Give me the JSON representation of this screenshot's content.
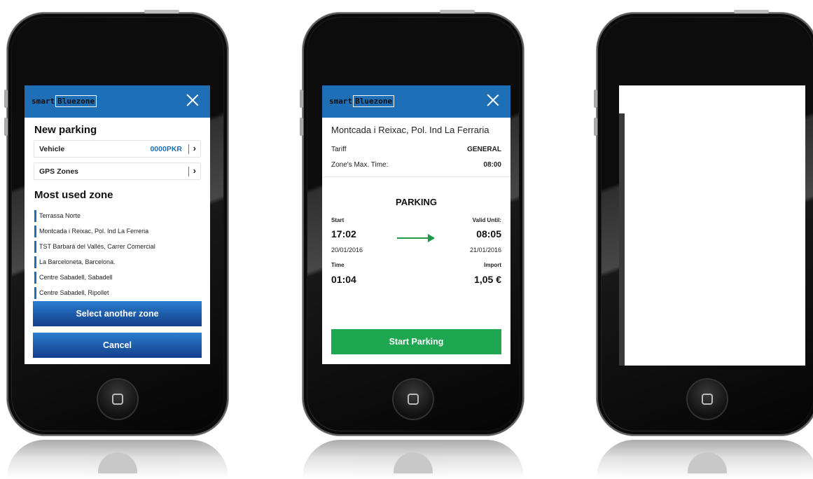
{
  "app": {
    "logo_prefix": "smart",
    "logo_brand": "Bluezone",
    "accent": "#1f6fb6",
    "success": "#1ea651"
  },
  "new_parking": {
    "title": "New parking",
    "vehicle_label": "Vehicle",
    "vehicle_value": "0000PKR",
    "gps_label": "GPS Zones",
    "most_used_title": "Most used zone",
    "zones": [
      "Terrassa Norte",
      "Montcada i Reixac, Pol. Ind La Ferreria",
      "TST Barbará del Vallés, Carrer Comercial",
      "La Barceloneta, Barcelona.",
      "Centre Sabadell, Sabadell",
      "Centre  Sabadell, Ripollet"
    ],
    "select_button": "Select another zone",
    "cancel_button": "Cancel"
  },
  "summary": {
    "location": "Montcada i Reixac, Pol. Ind La Ferraria",
    "tariff_label": "Tariff",
    "tariff_value": "GENERAL",
    "max_time_label": "Zone's Max. Time:",
    "max_time_value": "08:00",
    "parking_title": "PARKING",
    "start_label": "Start",
    "start_time": "17:02",
    "start_date": "20/01/2016",
    "valid_label": "Valid Until:",
    "valid_time": "08:05",
    "valid_date": "21/01/2016",
    "time_label": "Time",
    "time_value": "01:04",
    "import_label": "Import",
    "import_value": "1,05 €",
    "start_button": "Start Parking"
  }
}
